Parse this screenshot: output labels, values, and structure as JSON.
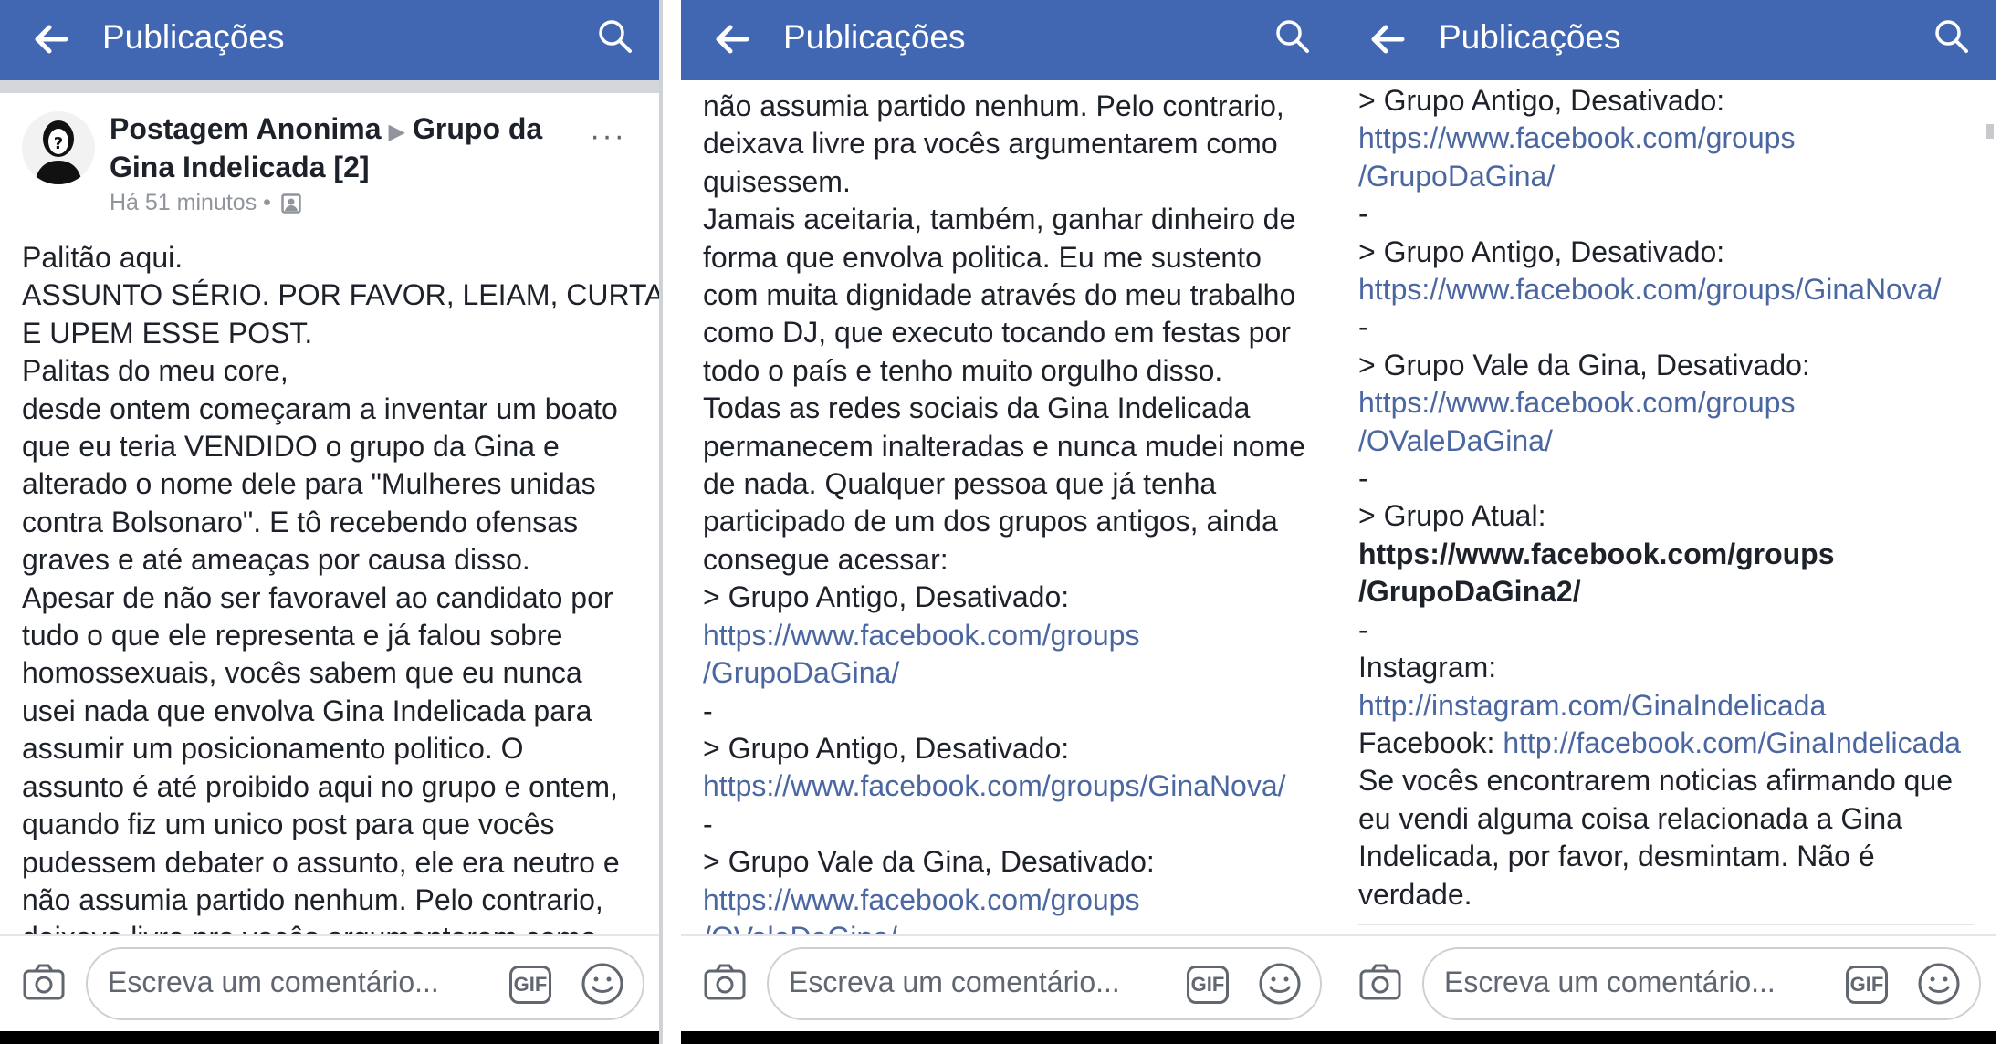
{
  "header": {
    "title": "Publicações"
  },
  "post": {
    "author": "Postagem Anonima",
    "group": "Grupo da Gina Indelicada [2]",
    "time": "Há 51 minutos",
    "more": "···"
  },
  "panel1": {
    "lines": [
      "Palitão aqui.",
      "ASSUNTO SÉRIO. POR FAVOR, LEIAM, CURTAM",
      "E UPEM ESSE POST.",
      "Palitas do meu core,",
      "desde ontem começaram a inventar um boato",
      "que eu teria VENDIDO o grupo da Gina e",
      "alterado o nome dele para \"Mulheres unidas",
      "contra Bolsonaro\". E tô recebendo ofensas",
      "graves e até ameaças por causa disso.",
      "Apesar de não ser favoravel ao candidato por",
      "tudo o que ele representa e já falou sobre",
      "homossexuais, vocês sabem que eu nunca",
      "usei nada que envolva Gina Indelicada para",
      "assumir um posicionamento politico. O",
      "assunto é até proibido aqui no grupo e ontem,",
      "quando fiz um unico post para que vocês",
      "pudessem debater o assunto, ele era neutro e",
      "não assumia partido nenhum. Pelo contrario,",
      "deixava livre pra vocês argumentarem como"
    ]
  },
  "panel2": {
    "lines": [
      "não assumia partido nenhum. Pelo contrario,",
      "deixava livre pra vocês argumentarem como",
      "quisessem.",
      "Jamais aceitaria, também, ganhar dinheiro de",
      "forma que envolva politica. Eu me sustento",
      "com muita dignidade através do meu trabalho",
      "como DJ, que executo tocando em festas por",
      "todo o país e tenho muito orgulho disso.",
      "Todas as redes sociais da Gina Indelicada",
      "permanecem inalteradas e nunca mudei nome",
      "de nada. Qualquer pessoa que já tenha",
      "participado de um dos grupos antigos, ainda",
      "consegue acessar:",
      "> Grupo Antigo, Desativado:"
    ],
    "link1a": "https://www.facebook.com/groups",
    "link1b": "/GrupoDaGina/",
    "dash1": "-",
    "label2": "> Grupo Antigo, Desativado:",
    "link2": "https://www.facebook.com/groups/GinaNova/",
    "dash2": "-",
    "label3": "> Grupo Vale da Gina, Desativado:",
    "link3a": "https://www.facebook.com/groups",
    "link3b": "/OValeDaGina/"
  },
  "panel3": {
    "label1": "> Grupo Antigo, Desativado:",
    "link1a": "https://www.facebook.com/groups",
    "link1b": "/GrupoDaGina/",
    "dash1": "-",
    "label2": "> Grupo Antigo, Desativado:",
    "link2": "https://www.facebook.com/groups/GinaNova/",
    "dash2": "-",
    "label3": "> Grupo Vale da Gina, Desativado:",
    "link3a": "https://www.facebook.com/groups",
    "link3b": "/OValeDaGina/",
    "dash3": "-",
    "label4": "> Grupo Atual:",
    "link4a": "https://www.facebook.com/groups",
    "link4b": "/GrupoDaGina2/",
    "dash4": "-",
    "insta_label": "Instagram:",
    "insta_link": "http://instagram.com/GinaIndelicada",
    "fb_label": "Facebook: ",
    "fb_link": "http://facebook.com/GinaIndelicada",
    "outro": [
      "Se vocês encontrarem noticias afirmando que",
      "eu vendi alguma coisa relacionada a Gina",
      "Indelicada, por favor, desmintam. Não é",
      "verdade."
    ]
  },
  "footer": {
    "placeholder": "Escreva um comentário...",
    "gif": "GIF"
  },
  "colors": {
    "header": "#4267b2",
    "link": "#4b67a1",
    "text": "#1d2129"
  }
}
